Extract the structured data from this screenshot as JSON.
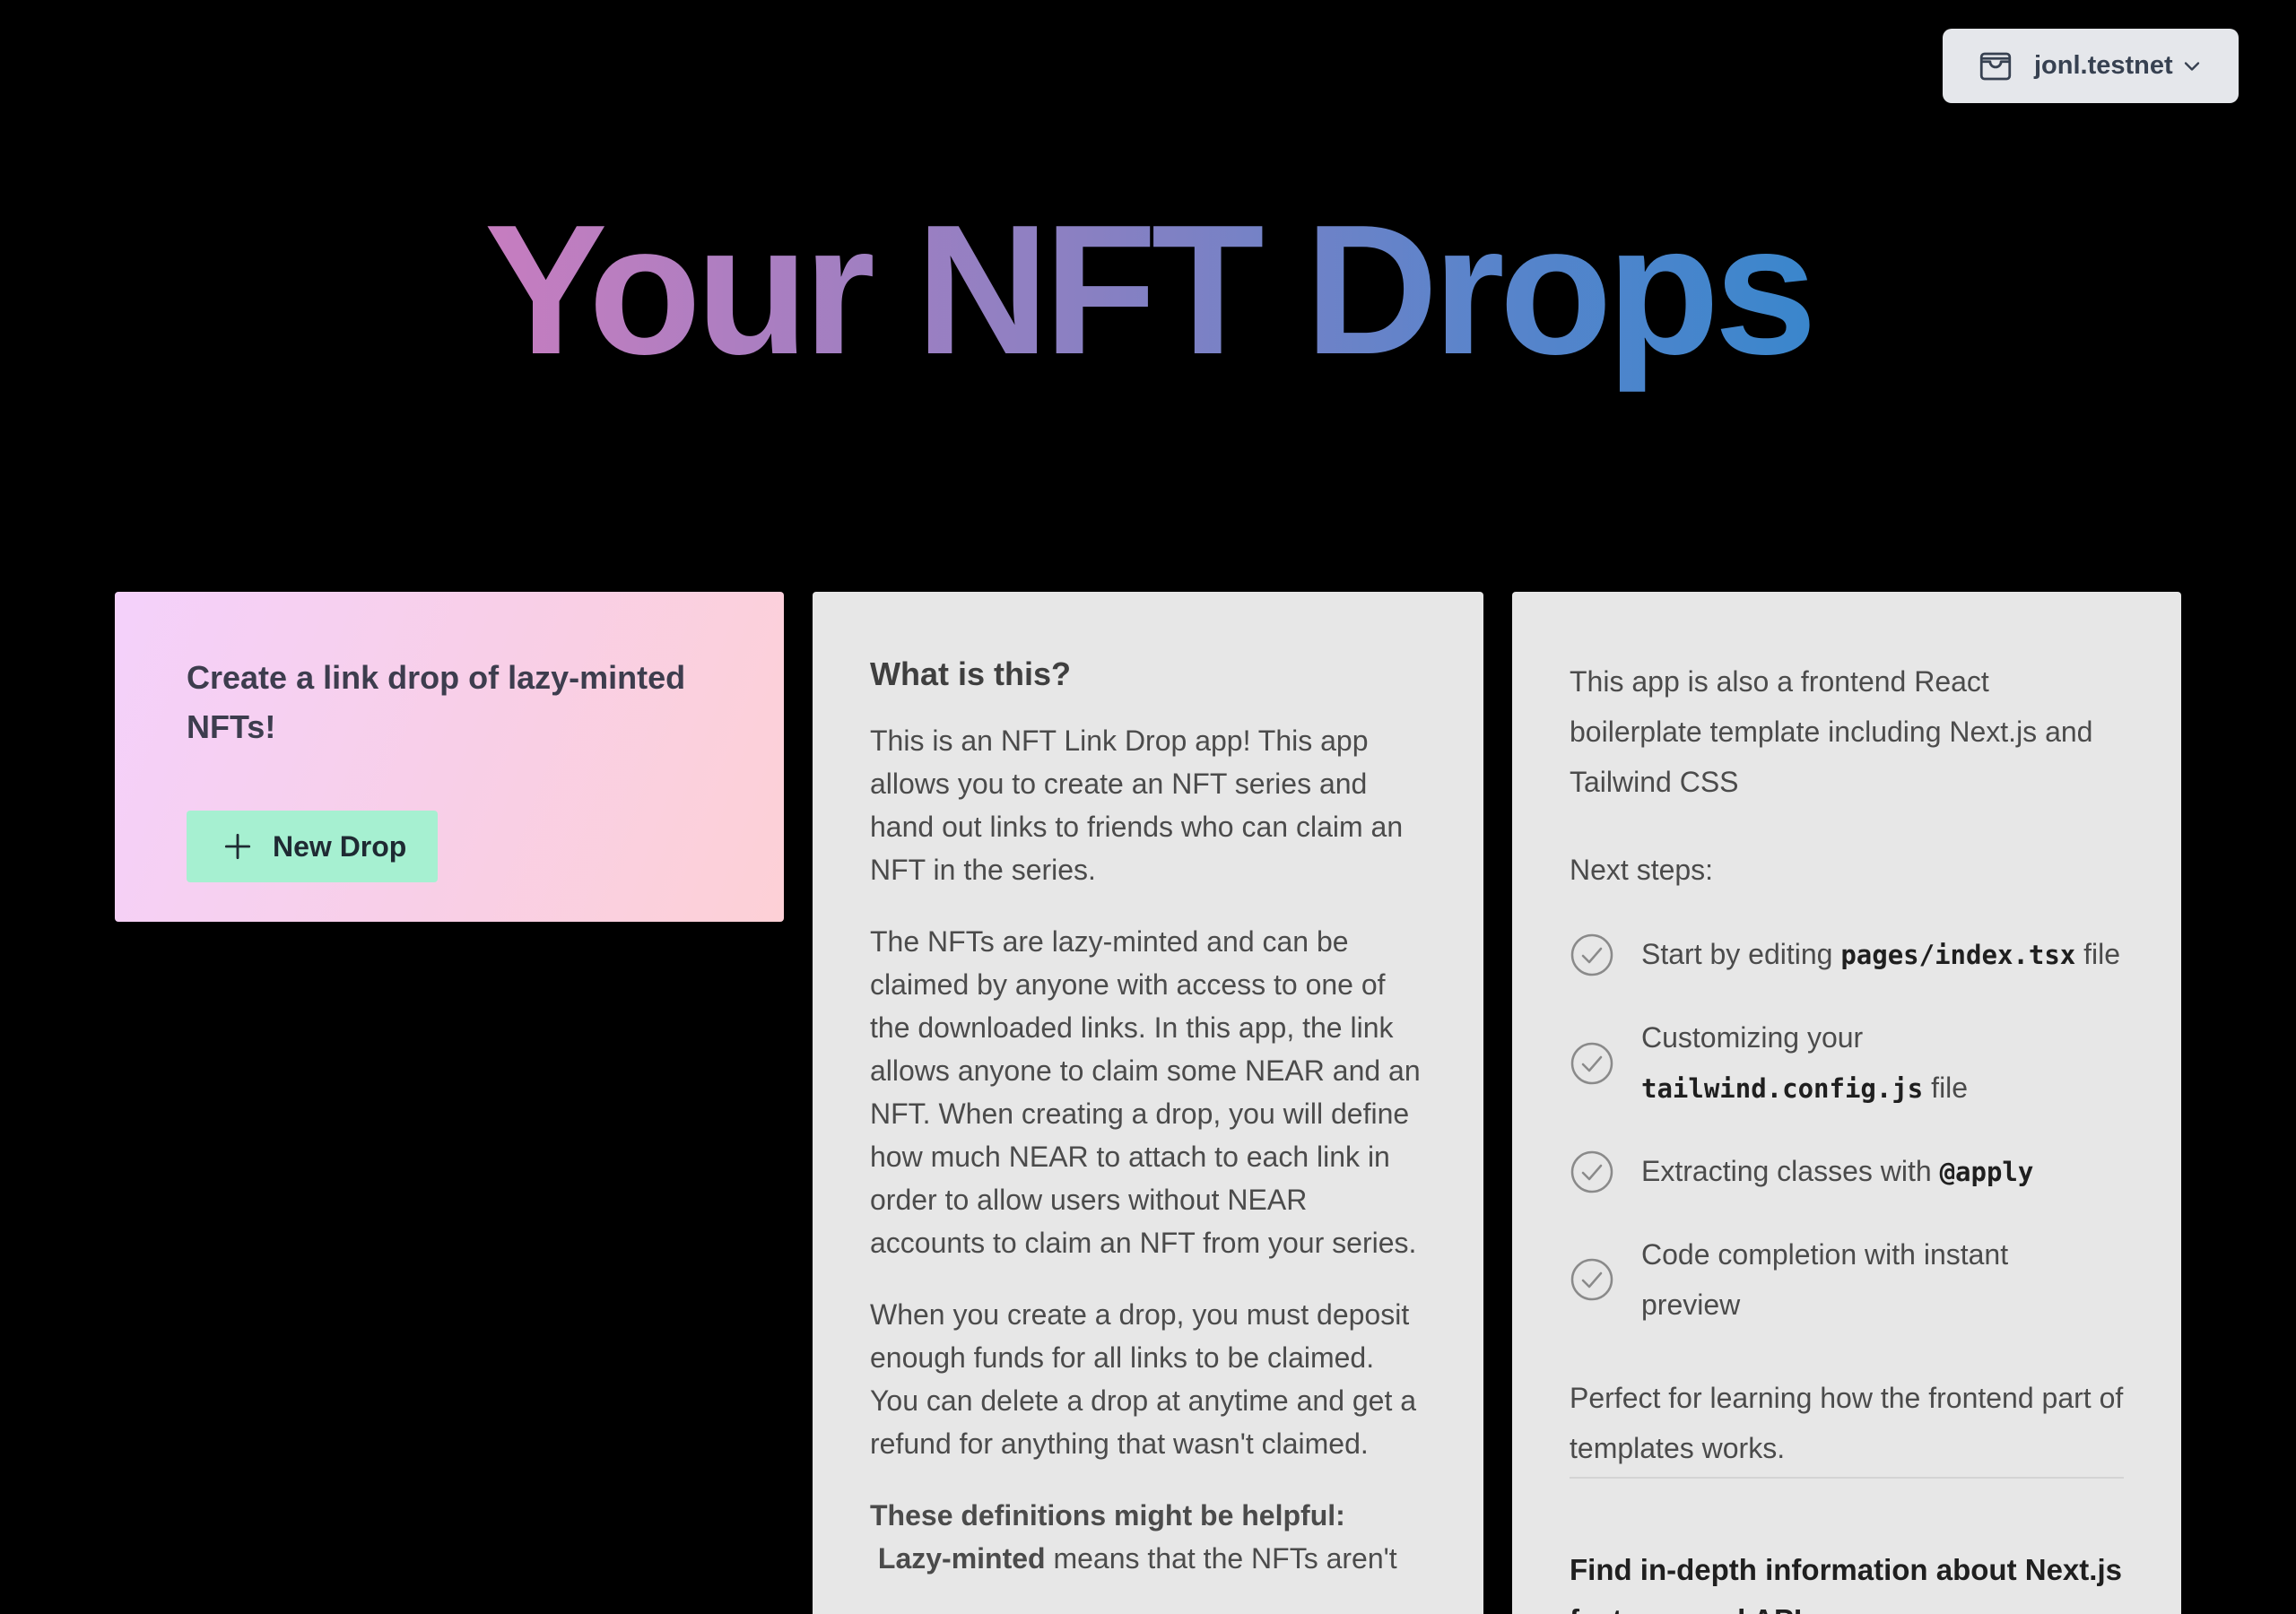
{
  "account": {
    "name": "jonl.testnet",
    "wallet_icon": "wallet-icon",
    "chevron_icon": "chevron-down-icon"
  },
  "header": {
    "title": "Your NFT Drops",
    "gradient": [
      "#c77dc0",
      "#8a80c2",
      "#5a84cb",
      "#3a86cc"
    ]
  },
  "create_card": {
    "heading": "Create a link drop of lazy-minted NFTs!",
    "button_label": "New Drop",
    "button_icon": "plus-icon",
    "button_color": "#a6f0d1"
  },
  "info_card": {
    "heading": "What is this?",
    "paragraphs": [
      "This is an NFT Link Drop app! This app allows you to create an NFT series and hand out links to friends who can claim an NFT in the series.",
      "The NFTs are lazy-minted and can be claimed by anyone with access to one of the downloaded links. In this app, the link allows anyone to claim some NEAR and an NFT. When creating a drop, you will define how much NEAR to attach to each link in order to allow users without NEAR accounts to claim an NFT from your series.",
      "When you create a drop, you must deposit enough funds for all links to be claimed. You can delete a drop at anytime and get a refund for anything that wasn't claimed."
    ],
    "definitions_title": "These definitions might be helpful:",
    "definition_1_term": "Lazy-minted",
    "definition_1_text": "means that the NFTs aren't"
  },
  "next_card": {
    "intro": "This app is also a frontend React boilerplate template including Next.js and Tailwind CSS",
    "steps_title": "Next steps:",
    "steps": [
      {
        "before": "Start by editing ",
        "code": "pages/index.tsx",
        "after": " file"
      },
      {
        "before": "Customizing your ",
        "code": "tailwind.config.js",
        "after": " file"
      },
      {
        "before": "Extracting classes with ",
        "code": "@apply",
        "after": ""
      },
      {
        "before": "Code completion with instant preview",
        "code": "",
        "after": ""
      }
    ],
    "perfect": "Perfect for learning how the frontend part of templates works.",
    "find": "Find in-depth information about Next.js features and API."
  }
}
